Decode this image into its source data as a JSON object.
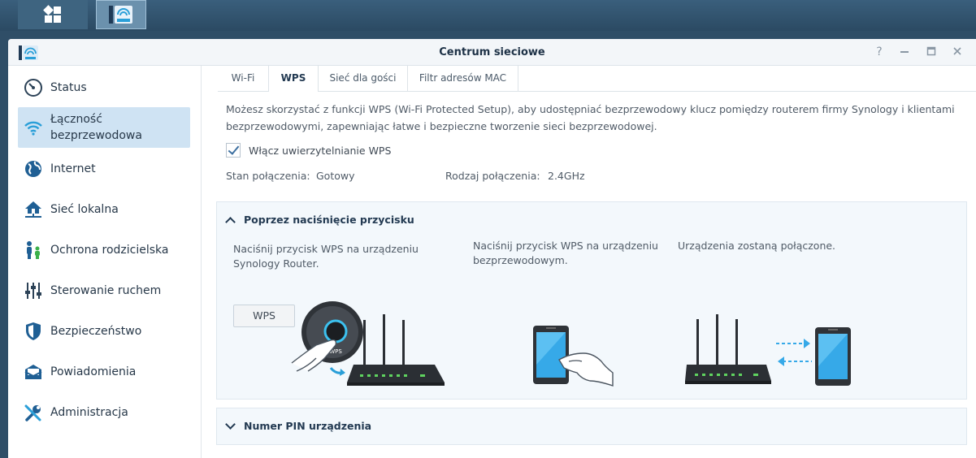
{
  "window": {
    "title": "Centrum sieciowe",
    "help": "?"
  },
  "sidebar": {
    "items": [
      {
        "label": "Status",
        "icon": "gauge-icon"
      },
      {
        "label": "Łączność bezprzewodowa",
        "icon": "wifi-icon"
      },
      {
        "label": "Internet",
        "icon": "globe-icon"
      },
      {
        "label": "Sieć lokalna",
        "icon": "home-network-icon"
      },
      {
        "label": "Ochrona rodzicielska",
        "icon": "family-icon"
      },
      {
        "label": "Sterowanie ruchem",
        "icon": "sliders-icon"
      },
      {
        "label": "Bezpieczeństwo",
        "icon": "shield-icon"
      },
      {
        "label": "Powiadomienia",
        "icon": "mail-icon"
      },
      {
        "label": "Administracja",
        "icon": "tools-icon"
      }
    ]
  },
  "tabs": [
    "Wi-Fi",
    "WPS",
    "Sieć dla gości",
    "Filtr adresów MAC"
  ],
  "description": "Możesz skorzystać z funkcji WPS (Wi-Fi Protected Setup), aby udostępniać bezprzewodowy klucz pomiędzy routerem firmy Synology i klientami bezprzewodowymi, zapewniając łatwe i bezpieczne tworzenie sieci bezprzewodowej.",
  "wps_enable": {
    "label": "Włącz uwierzytelnianie WPS",
    "checked": true
  },
  "status": {
    "state_label": "Stan połączenia:",
    "state_value": "Gotowy",
    "type_label": "Rodzaj połączenia:",
    "type_value": "2.4GHz"
  },
  "push_section": {
    "title": "Poprzez naciśnięcie przycisku",
    "step1": "Naciśnij przycisk WPS na urządzeniu Synology Router.",
    "step2": "Naciśnij przycisk WPS na urządzeniu bezprzewodowym.",
    "step3": "Urządzenia zostaną połączone.",
    "button": "WPS",
    "router_button_text": "WPS"
  },
  "pin_section": {
    "title": "Numer PIN urządzenia"
  },
  "colors": {
    "accent": "#2a9fd8",
    "sidebar_active": "#cfe3f3",
    "led": "#5fd35f"
  }
}
